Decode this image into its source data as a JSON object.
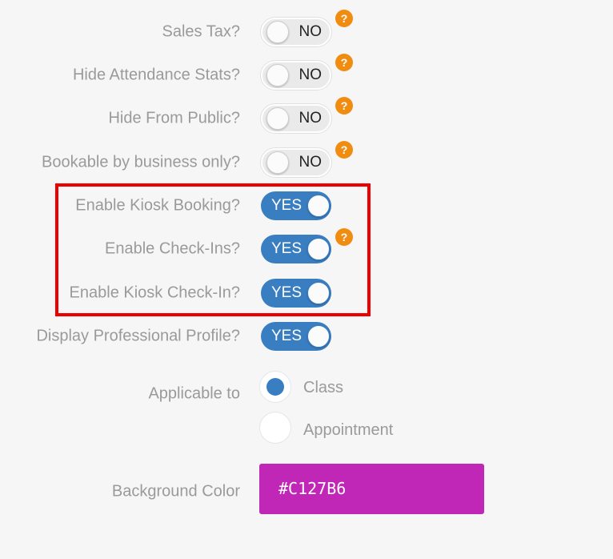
{
  "toggles": [
    {
      "label": "Sales Tax?",
      "state": "NO",
      "help": "?"
    },
    {
      "label": "Hide Attendance Stats?",
      "state": "NO",
      "help": "?"
    },
    {
      "label": "Hide From Public?",
      "state": "NO",
      "help": "?"
    },
    {
      "label": "Bookable by business only?",
      "state": "NO",
      "help": "?"
    },
    {
      "label": "Enable Kiosk Booking?",
      "state": "YES"
    },
    {
      "label": "Enable Check-Ins?",
      "state": "YES",
      "help": "?"
    },
    {
      "label": "Enable Kiosk Check-In?",
      "state": "YES"
    },
    {
      "label": "Display Professional Profile?",
      "state": "YES"
    }
  ],
  "applicable": {
    "label": "Applicable to",
    "options": [
      {
        "label": "Class",
        "selected": true
      },
      {
        "label": "Appointment",
        "selected": false
      }
    ]
  },
  "background": {
    "label": "Background Color",
    "value": "#C127B6",
    "color": "#C127B6"
  },
  "colors": {
    "toggle_on": "#3a7ec2",
    "help_badge": "#f08c10",
    "highlight_border": "#ee0000"
  }
}
